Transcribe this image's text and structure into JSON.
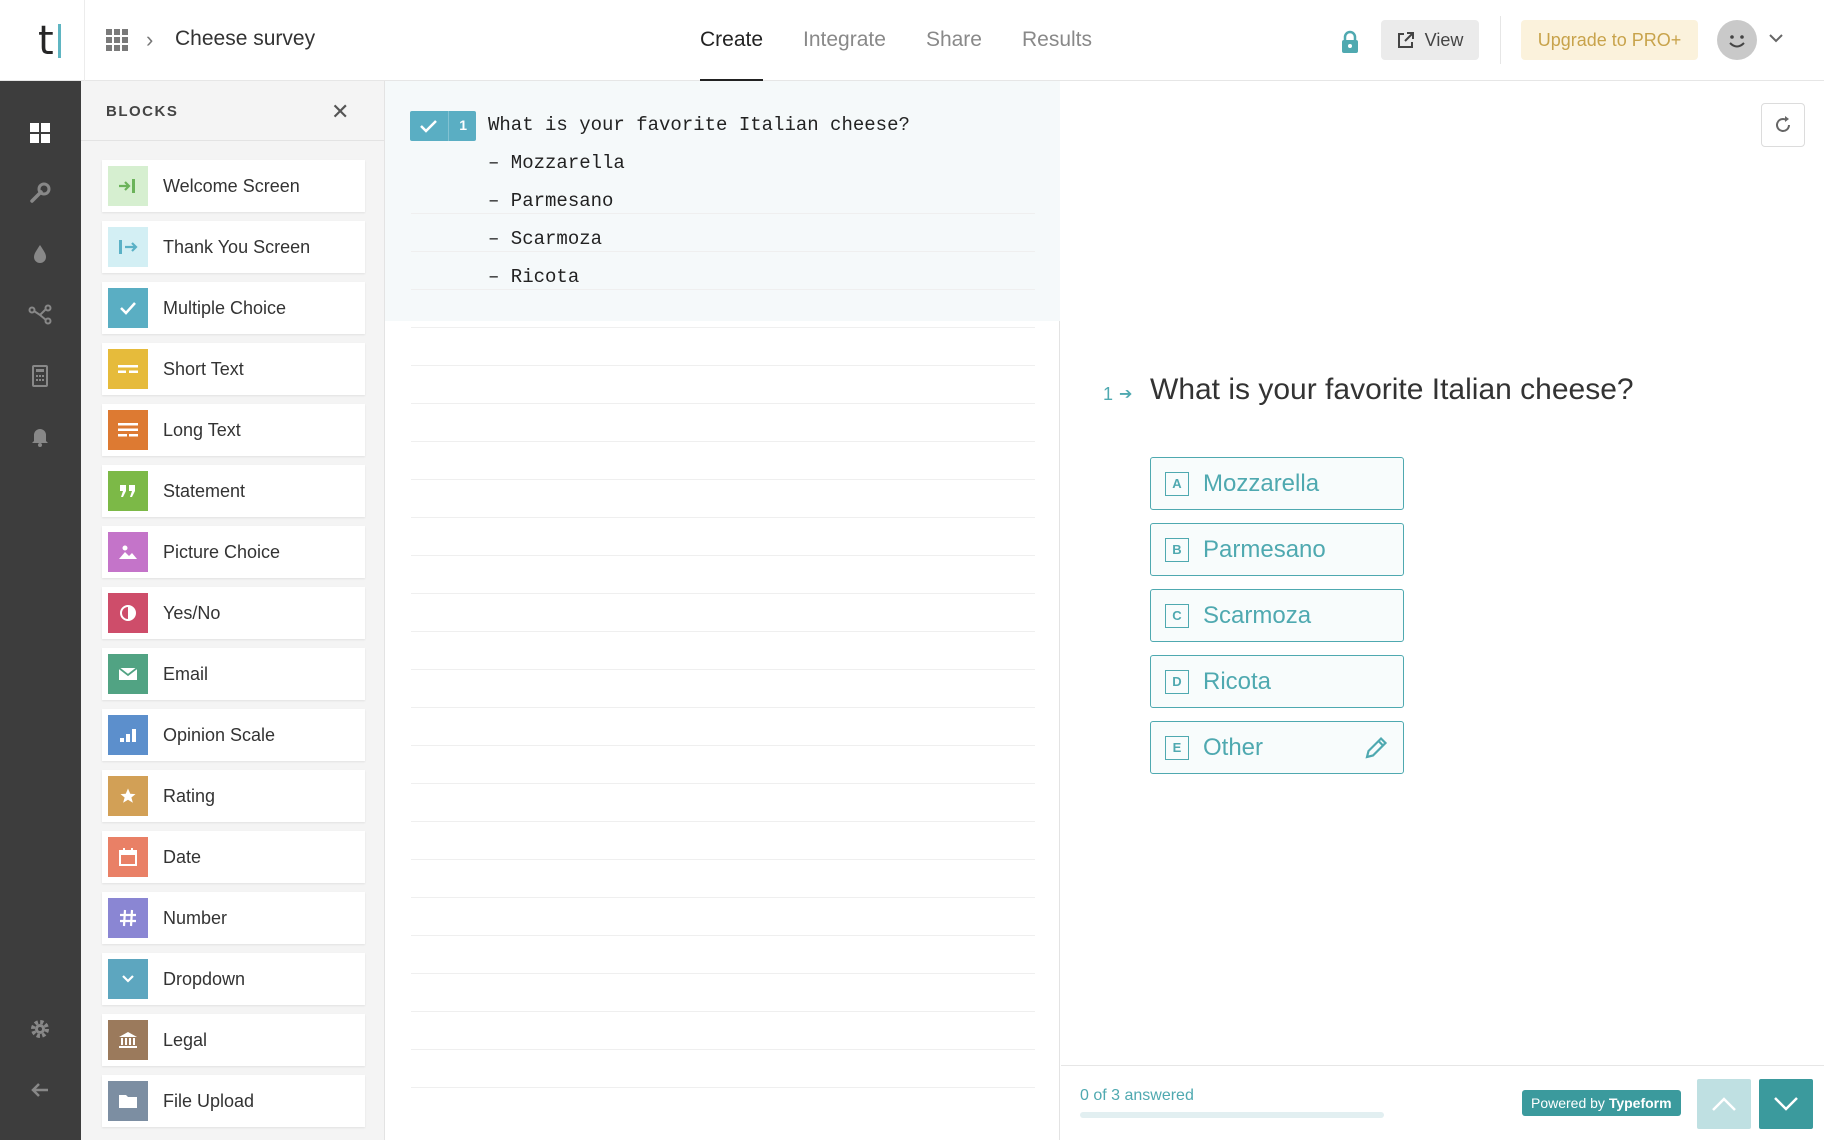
{
  "app": {
    "logo_letter": "t",
    "survey_title": "Cheese survey"
  },
  "nav": {
    "tabs": [
      {
        "label": "Create",
        "active": true
      },
      {
        "label": "Integrate",
        "active": false
      },
      {
        "label": "Share",
        "active": false
      },
      {
        "label": "Results",
        "active": false
      }
    ],
    "view_label": "View",
    "upgrade_label": "Upgrade to PRO+"
  },
  "rail": {
    "icons": [
      "blocks-grid-icon",
      "wrench-icon",
      "drop-icon",
      "logic-branch-icon",
      "calculator-icon",
      "bell-icon",
      "gear-icon",
      "arrow-left-icon"
    ]
  },
  "blocks_panel": {
    "title": "BLOCKS",
    "items": [
      {
        "label": "Welcome Screen",
        "icon": "welcome-screen-icon",
        "color": "#d6efd0"
      },
      {
        "label": "Thank You Screen",
        "icon": "thank-you-screen-icon",
        "color": "#d3eff4"
      },
      {
        "label": "Multiple Choice",
        "icon": "checkmark-icon",
        "color": "#5aaec3"
      },
      {
        "label": "Short Text",
        "icon": "short-text-icon",
        "color": "#e6bb3b"
      },
      {
        "label": "Long Text",
        "icon": "long-text-icon",
        "color": "#dd7a32"
      },
      {
        "label": "Statement",
        "icon": "quote-icon",
        "color": "#7cb947"
      },
      {
        "label": "Picture Choice",
        "icon": "picture-icon",
        "color": "#c474c9"
      },
      {
        "label": "Yes/No",
        "icon": "yes-no-icon",
        "color": "#ce4d6a"
      },
      {
        "label": "Email",
        "icon": "envelope-icon",
        "color": "#51a383"
      },
      {
        "label": "Opinion Scale",
        "icon": "opinion-scale-icon",
        "color": "#5c8fcc"
      },
      {
        "label": "Rating",
        "icon": "star-icon",
        "color": "#d2a056"
      },
      {
        "label": "Date",
        "icon": "calendar-icon",
        "color": "#e98066"
      },
      {
        "label": "Number",
        "icon": "hash-icon",
        "color": "#8a86d3"
      },
      {
        "label": "Dropdown",
        "icon": "chevron-down-icon",
        "color": "#5da6bf"
      },
      {
        "label": "Legal",
        "icon": "legal-bank-icon",
        "color": "#9b7a5c"
      },
      {
        "label": "File Upload",
        "icon": "folder-icon",
        "color": "#7c8ea2"
      }
    ]
  },
  "editor": {
    "question_number": "1",
    "question_line": "What is your favorite Italian cheese?",
    "option_lines": [
      "– Mozzarella",
      "– Parmesano",
      "– Scarmoza",
      "– Ricota"
    ]
  },
  "preview": {
    "question_number": "1",
    "question_text": "What is your favorite Italian cheese?",
    "choices": [
      {
        "key": "A",
        "label": "Mozzarella"
      },
      {
        "key": "B",
        "label": "Parmesano"
      },
      {
        "key": "C",
        "label": "Scarmoza"
      },
      {
        "key": "D",
        "label": "Ricota"
      },
      {
        "key": "E",
        "label": "Other"
      }
    ],
    "progress_text": "0 of 3 answered",
    "progress_fraction": 0,
    "powered_prefix": "Powered by",
    "powered_brand": "Typeform",
    "accent_color": "#4fa9b0"
  }
}
